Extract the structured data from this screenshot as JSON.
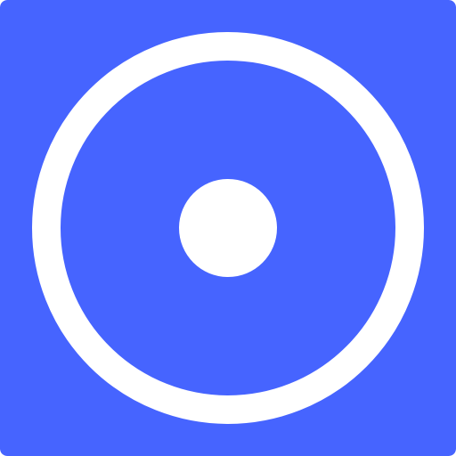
{
  "icon": {
    "name": "record-icon",
    "colors": {
      "background": "#4664FF",
      "foreground": "#FFFFFF"
    }
  }
}
